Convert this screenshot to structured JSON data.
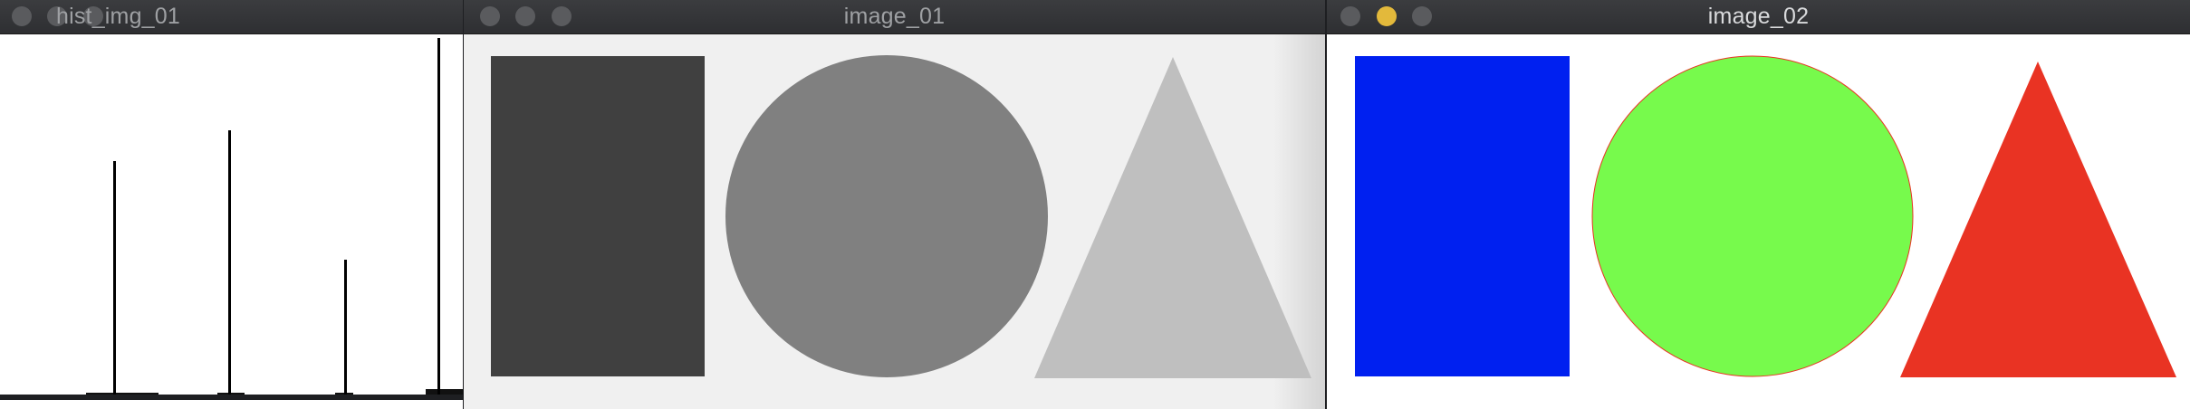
{
  "windows": [
    {
      "title": "hist_img_01",
      "traffic_lights": [
        "close",
        "minimize",
        "zoom"
      ],
      "active": false
    },
    {
      "title": "image_01",
      "traffic_lights": [
        "close",
        "minimize",
        "zoom"
      ],
      "active": false
    },
    {
      "title": "image_02",
      "traffic_lights": [
        "close",
        "minimize",
        "zoom"
      ],
      "active": true
    }
  ],
  "histogram": {
    "peaks": [
      {
        "bin": 64,
        "relative_height": 0.66
      },
      {
        "bin": 127,
        "relative_height": 0.75
      },
      {
        "bin": 191,
        "relative_height": 0.39
      },
      {
        "bin": 243,
        "relative_height": 1.0
      }
    ]
  },
  "image_01": {
    "background": "#f0f0f0",
    "shapes": [
      {
        "type": "rectangle",
        "color": "#404040"
      },
      {
        "type": "circle",
        "color": "#808080"
      },
      {
        "type": "triangle",
        "color": "#bfbfbf"
      }
    ]
  },
  "image_02": {
    "background": "#ffffff",
    "shapes": [
      {
        "type": "rectangle",
        "color": "#0020f0"
      },
      {
        "type": "circle",
        "color": "#77fa4c"
      },
      {
        "type": "triangle",
        "color": "#e93323"
      }
    ]
  }
}
